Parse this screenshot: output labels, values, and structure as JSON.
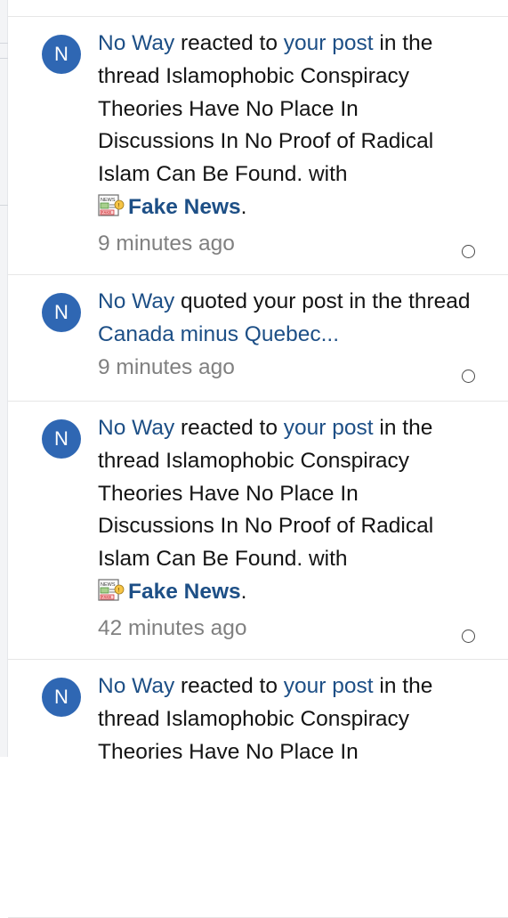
{
  "alerts": [
    {
      "avatar_letter": "N",
      "user": "No Way",
      "action": " reacted to ",
      "target": "your post",
      "text_before_thread": " in the thread ",
      "thread": "Islamophobic Conspiracy Theories Have No Place In Discussions In No Proof of Radical Islam Can Be Found.",
      "with_text": " with",
      "reaction": "Fake News",
      "reaction_icon": "fake-news-icon",
      "trailing": ".",
      "time": "9 minutes ago"
    },
    {
      "avatar_letter": "N",
      "user": "No Way",
      "action": " quoted your post in the thread ",
      "thread": "Canada minus Quebec...",
      "time": "9 minutes ago"
    },
    {
      "avatar_letter": "N",
      "user": "No Way",
      "action": " reacted to ",
      "target": "your post",
      "text_before_thread": " in the thread ",
      "thread": "Islamophobic Conspiracy Theories Have No Place In Discussions In No Proof of Radical Islam Can Be Found.",
      "with_text": " with",
      "reaction": "Fake News",
      "reaction_icon": "fake-news-icon",
      "trailing": ".",
      "time": "42 minutes ago"
    },
    {
      "avatar_letter": "N",
      "user": "No Way",
      "action": " reacted to ",
      "target": "your post",
      "text_before_thread": " in the thread ",
      "thread": "Islamophobic Conspiracy Theories Have No Place In"
    }
  ],
  "colors": {
    "avatar_bg": "#2f67b3",
    "link": "#1d4f86",
    "time": "#808080",
    "divider": "#e6e6e6"
  }
}
